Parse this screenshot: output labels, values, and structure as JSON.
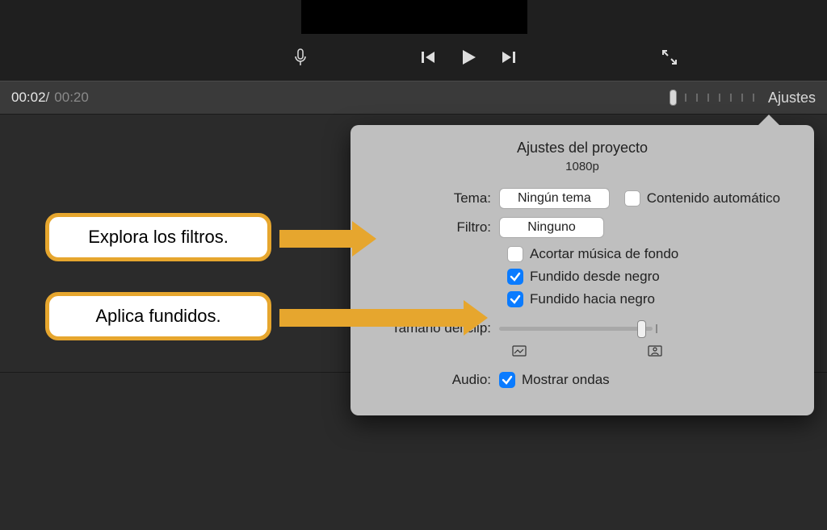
{
  "time": {
    "current": "00:02",
    "sep": " / ",
    "total": "00:20"
  },
  "ajustes_label": "Ajustes",
  "popover": {
    "title": "Ajustes del proyecto",
    "subtitle": "1080p",
    "theme_label": "Tema:",
    "theme_value": "Ningún tema",
    "auto_content_label": "Contenido automático",
    "filter_label": "Filtro:",
    "filter_value": "Ninguno",
    "shorten_music_label": "Acortar música de fondo",
    "fade_from_black_label": "Fundido desde negro",
    "fade_to_black_label": "Fundido hacia negro",
    "clip_size_label": "Tamaño del clip:",
    "audio_label": "Audio:",
    "show_waveforms_label": "Mostrar ondas",
    "checks": {
      "auto_content": false,
      "shorten_music": false,
      "fade_from_black": true,
      "fade_to_black": true,
      "show_waveforms": true
    }
  },
  "callouts": {
    "filters": "Explora los filtros.",
    "fades": "Aplica fundidos."
  }
}
